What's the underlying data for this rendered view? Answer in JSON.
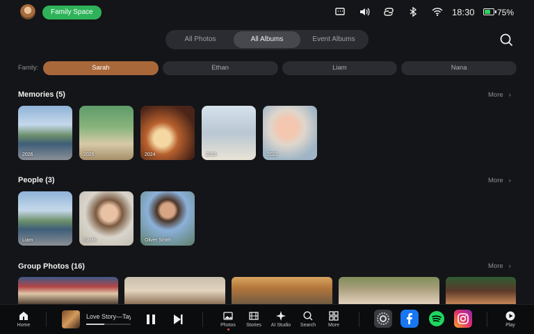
{
  "status_bar": {
    "family_space_label": "Family Space",
    "time": "18:30",
    "battery_percent": "75%",
    "battery_level": 0.75,
    "icons": [
      "message-icon",
      "volume-icon",
      "link-icon",
      "bluetooth-icon",
      "wifi-icon"
    ]
  },
  "tabs": [
    {
      "label": "All Photos",
      "active": false
    },
    {
      "label": "All Albums",
      "active": true
    },
    {
      "label": "Event Albums",
      "active": false
    }
  ],
  "family": {
    "label": "Family:",
    "members": [
      "Sarah",
      "Ethan",
      "Liam",
      "Nana"
    ],
    "selected": "Sarah"
  },
  "sections": {
    "memories": {
      "title": "Memories (5)",
      "more": "More",
      "items": [
        {
          "caption": "2026",
          "photo": "monument"
        },
        {
          "caption": "2025",
          "photo": "kid-park"
        },
        {
          "caption": "2024",
          "photo": "cake"
        },
        {
          "caption": "2023",
          "photo": "baby"
        },
        {
          "caption": "2022",
          "photo": "newborn"
        }
      ]
    },
    "people": {
      "title": "People  (3)",
      "more": "More",
      "items": [
        {
          "caption": "Liam",
          "photo": "monument"
        },
        {
          "caption": "Sarah",
          "photo": "woman"
        },
        {
          "caption": "Oliver Smith",
          "photo": "man"
        }
      ]
    },
    "group_photos": {
      "title": "Group Photos (16)",
      "more": "More"
    }
  },
  "dock": {
    "home": "Home",
    "now_playing": {
      "title": "Love Story—Taylor Swift",
      "progress": 0.4
    },
    "nav": [
      "Photos",
      "Stories",
      "AI Studio",
      "Search",
      "More"
    ],
    "active_nav": "Photos",
    "apps": [
      "settings-icon",
      "facebook-icon",
      "spotify-icon",
      "instagram-icon"
    ],
    "play": "Play"
  },
  "colors": {
    "accent": "#a9683a",
    "family_pill": "#2fb35a",
    "background": "#141518"
  }
}
